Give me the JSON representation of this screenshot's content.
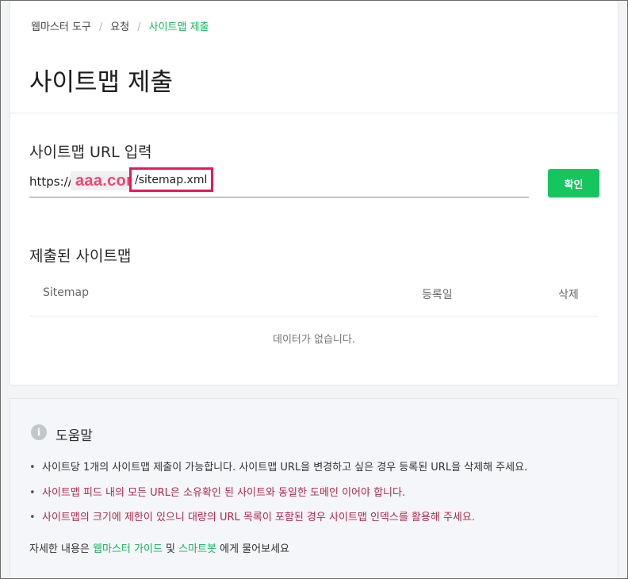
{
  "breadcrumb": {
    "items": [
      "웹마스터 도구",
      "요청"
    ],
    "current": "사이트맵 제출",
    "separator": "/"
  },
  "page_title": "사이트맵 제출",
  "url_section": {
    "label": "사이트맵 URL 입력",
    "prefix": "https://",
    "domain": "aaa.com",
    "input_value": "/sitemap.xml",
    "confirm_label": "확인"
  },
  "submitted_section": {
    "label": "제출된 사이트맵",
    "columns": [
      "Sitemap",
      "등록일",
      "삭제"
    ],
    "empty_message": "데이터가 없습니다."
  },
  "help": {
    "title": "도움말",
    "tips": [
      "사이트당 1개의 사이트맵 제출이 가능합니다. 사이트맵 URL을 변경하고 싶은 경우 등록된 URL을 삭제해 주세요.",
      "사이트맵 피드 내의 모든 URL은 소유확인 된 사이트와 동일한 도메인 이어야 합니다.",
      "사이트맵의 크기에 제한이 있으니 대량의 URL 목록이 포함된 경우 사이트맵 인덱스를 활용해 주세요."
    ],
    "footer_prefix": "자세한 내용은",
    "guide_link": "웹마스터 가이드",
    "and": "및",
    "bot_link": "스마트봇",
    "footer_suffix": "에게 물어보세요"
  },
  "colors": {
    "accent_green": "#19b35a",
    "button_green": "#15c55e",
    "highlight_pink": "#e8175d",
    "warning_red": "#b3284a"
  },
  "icons": {
    "help": "info-icon"
  }
}
